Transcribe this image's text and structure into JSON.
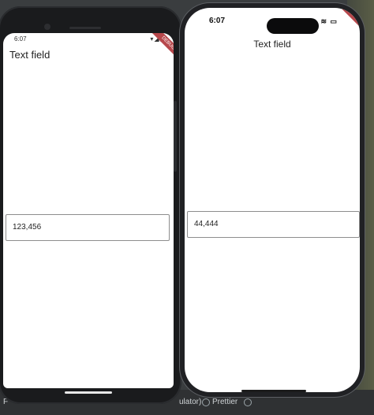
{
  "devices": {
    "android": {
      "status_time": "6:07",
      "status_icons": "▾◢▮",
      "app_title": "Text field",
      "textfield_value": "123,456",
      "debug_badge": "DEBUG"
    },
    "iphone": {
      "status_time": "6:07",
      "status_icons": "≋ ▭",
      "app_title": "Text field",
      "textfield_value": "44,444",
      "debug_badge": "DEBUG"
    }
  },
  "desktop_bar": {
    "left_label": "F",
    "middle_label": "ulator)",
    "prettier_label": "Prettier"
  },
  "colors": {
    "debug_ribbon": "#b7474b",
    "field_border": "#8d8d8d",
    "device_frame_android": "#1a1b1d",
    "device_frame_iphone": "#202124"
  },
  "icons": {
    "android_status": [
      "wifi-icon",
      "signal-icon",
      "battery-icon"
    ],
    "iphone_status": [
      "wifi-icon",
      "battery-icon"
    ]
  }
}
